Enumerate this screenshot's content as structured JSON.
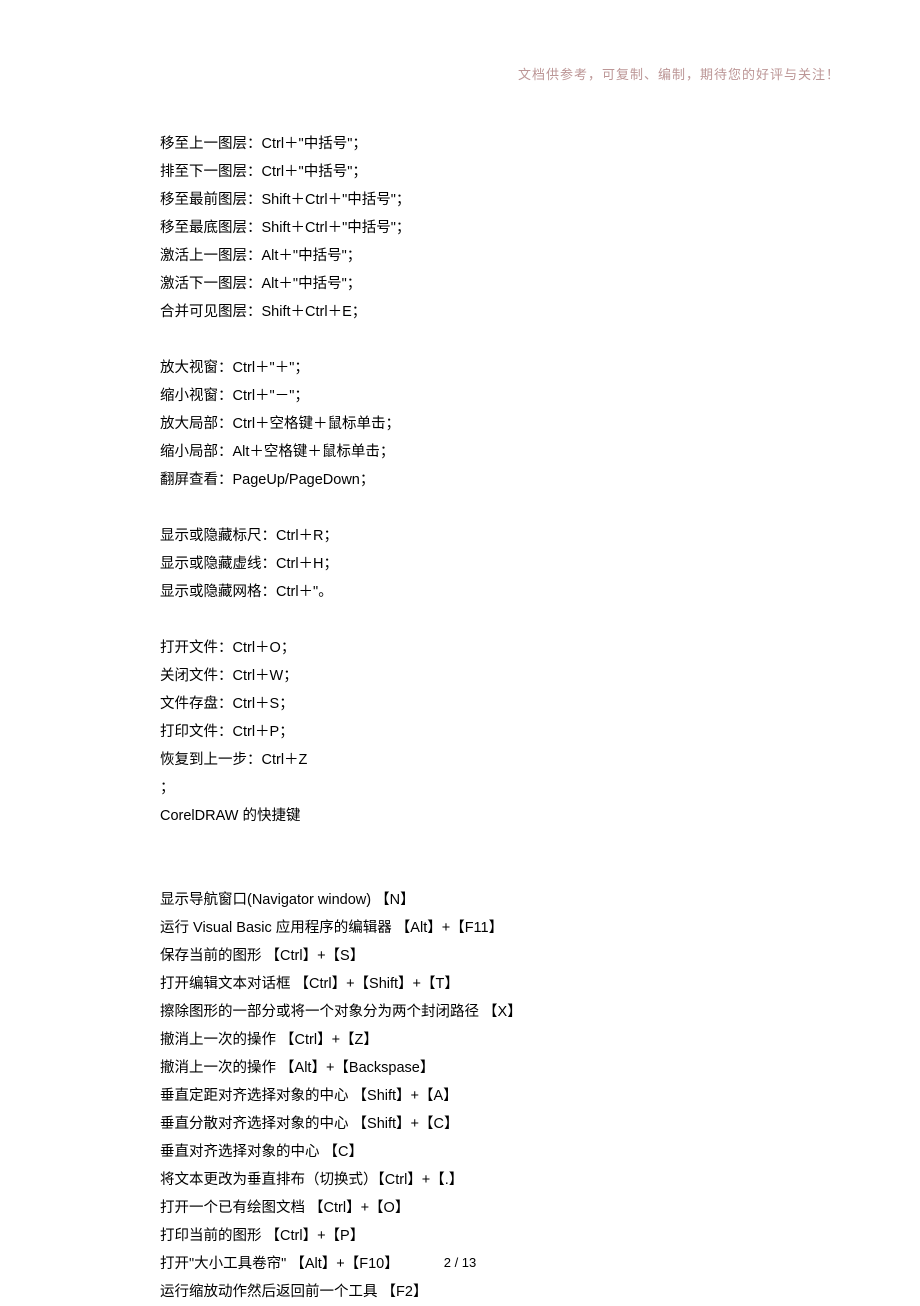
{
  "header": "文档供参考，可复制、编制，期待您的好评与关注！",
  "footer": "2  / 13",
  "lines": [
    "移至上一图层：Ctrl＋\"中括号\"；",
    "排至下一图层：Ctrl＋\"中括号\"；",
    "移至最前图层：Shift＋Ctrl＋\"中括号\"；",
    "移至最底图层：Shift＋Ctrl＋\"中括号\"；",
    "激活上一图层：Alt＋\"中括号\"；",
    "激活下一图层：Alt＋\"中括号\"；",
    "合并可见图层：Shift＋Ctrl＋E；",
    "",
    "放大视窗：Ctrl＋\"＋\"；",
    "缩小视窗：Ctrl＋\"－\"；",
    "放大局部：Ctrl＋空格键＋鼠标单击；",
    "缩小局部：Alt＋空格键＋鼠标单击；",
    "翻屏查看：PageUp/PageDown；",
    "",
    "显示或隐藏标尺：Ctrl＋R；",
    "显示或隐藏虚线：Ctrl＋H；",
    "显示或隐藏网格：Ctrl＋\"。",
    "",
    "打开文件：Ctrl＋O；",
    "关闭文件：Ctrl＋W；",
    "文件存盘：Ctrl＋S；",
    "打印文件：Ctrl＋P；",
    "恢复到上一步：Ctrl＋Z",
    "；",
    "CorelDRAW 的快捷键",
    "",
    "",
    "显示导航窗口(Navigator window) 【N】",
    "运行 Visual Basic 应用程序的编辑器 【Alt】+【F11】",
    "保存当前的图形 【Ctrl】+【S】",
    "打开编辑文本对话框 【Ctrl】+【Shift】+【T】",
    "擦除图形的一部分或将一个对象分为两个封闭路径 【X】",
    "撤消上一次的操作 【Ctrl】+【Z】",
    "撤消上一次的操作 【Alt】+【Backspase】",
    "垂直定距对齐选择对象的中心 【Shift】+【A】",
    "垂直分散对齐选择对象的中心 【Shift】+【C】",
    "垂直对齐选择对象的中心 【C】",
    "将文本更改为垂直排布（切换式）【Ctrl】+【.】",
    "打开一个已有绘图文档 【Ctrl】+【O】",
    "打印当前的图形 【Ctrl】+【P】",
    "打开\"大小工具卷帘\" 【Alt】+【F10】",
    "运行缩放动作然后返回前一个工具 【F2】"
  ]
}
